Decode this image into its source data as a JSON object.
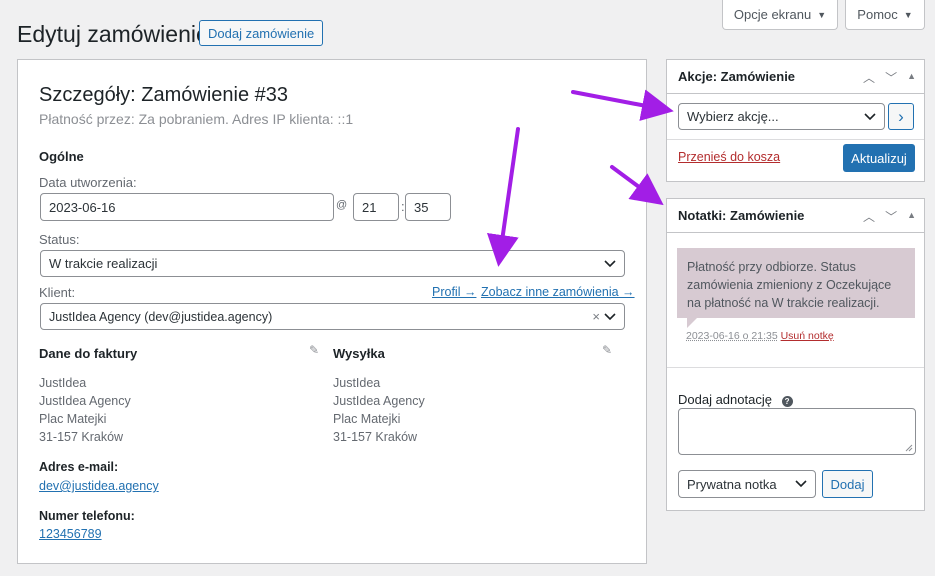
{
  "screen_options": {
    "label": "Opcje ekranu"
  },
  "help": {
    "label": "Pomoc"
  },
  "page": {
    "title": "Edytuj zamówienie",
    "add_button": "Dodaj zamówienie"
  },
  "order": {
    "heading": "Szczegóły: Zamówienie #33",
    "subheading": "Płatność przez: Za pobraniem. Adres IP klienta: ::1",
    "general_title": "Ogólne",
    "date_label": "Data utworzenia:",
    "date_value": "2023-06-16",
    "at_sign": "@",
    "hour": "21",
    "time_sep": ":",
    "minute": "35",
    "status_label": "Status:",
    "status_value": "W trakcie realizacji",
    "customer_label": "Klient:",
    "profile_link": "Profil →",
    "other_orders_link": "Zobacz inne zamówienia →",
    "customer_value": "JustIdea Agency (dev@justidea.agency)",
    "clear_symbol": "×"
  },
  "billing": {
    "title": "Dane do faktury",
    "lines": [
      "JustIdea",
      "JustIdea Agency",
      "Plac Matejki",
      "31-157 Kraków"
    ],
    "email_label": "Adres e-mail:",
    "email": "dev@justidea.agency",
    "phone_label": "Numer telefonu:",
    "phone": "123456789"
  },
  "shipping": {
    "title": "Wysyłka",
    "lines": [
      "JustIdea",
      "JustIdea Agency",
      "Plac Matejki",
      "31-157 Kraków"
    ]
  },
  "actions_box": {
    "title": "Akcje: Zamówienie",
    "select_placeholder": "Wybierz akcję...",
    "go_symbol": "›",
    "trash_link": "Przenieś do kosza",
    "update_button": "Aktualizuj"
  },
  "notes_box": {
    "title": "Notatki: Zamówienie",
    "note_text": "Płatność przy odbiorze. Status zamówienia zmieniony z Oczekujące na płatność na W trakcie realizacji.",
    "note_meta": "2023-06-16 o 21:35",
    "delete_note": "Usuń notkę",
    "add_note_label": "Dodaj adnotację",
    "help_symbol": "?",
    "note_type": "Prywatna notka",
    "add_button": "Dodaj"
  },
  "colors": {
    "accent": "#2271b1",
    "annotation_arrow": "#a21ee6",
    "danger": "#b32d2e"
  }
}
